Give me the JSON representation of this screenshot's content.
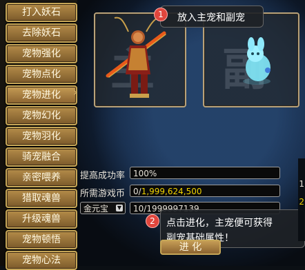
{
  "sidebar": {
    "items": [
      {
        "label": "打入妖石"
      },
      {
        "label": "去除妖石"
      },
      {
        "label": "宠物强化"
      },
      {
        "label": "宠物点化"
      },
      {
        "label": "宠物进化"
      },
      {
        "label": "宠物幻化"
      },
      {
        "label": "宠物羽化"
      },
      {
        "label": "骑宠融合"
      },
      {
        "label": "亲密喂养"
      },
      {
        "label": "猎取魂兽"
      },
      {
        "label": "升级魂兽"
      },
      {
        "label": "宠物顿悟"
      },
      {
        "label": "宠物心法"
      }
    ],
    "active_index": 4
  },
  "slots": {
    "main_watermark": "主",
    "sub_watermark": "副"
  },
  "callouts": {
    "one": {
      "number": "1",
      "text": "放入主宠和副宠"
    },
    "two": {
      "number": "2",
      "line1": "点击进化，主宠便可获得",
      "line2": "副宠基础属性！"
    }
  },
  "form": {
    "success_label": "提高成功率",
    "success_value": "100%",
    "cost_label": "所需游戏币",
    "cost_value_prefix": "0/",
    "cost_value_highlight": "1,999,624,500",
    "currency_select": "金元宝",
    "currency_value": "10/1999997139"
  },
  "buttons": {
    "evolve_label": "进 化"
  },
  "right_edge": {
    "n1": "1",
    "n2": "2"
  },
  "colors": {
    "accent_gold": "#c7a758",
    "badge_red": "#e1463d",
    "highlight_yellow": "#f0d300"
  }
}
